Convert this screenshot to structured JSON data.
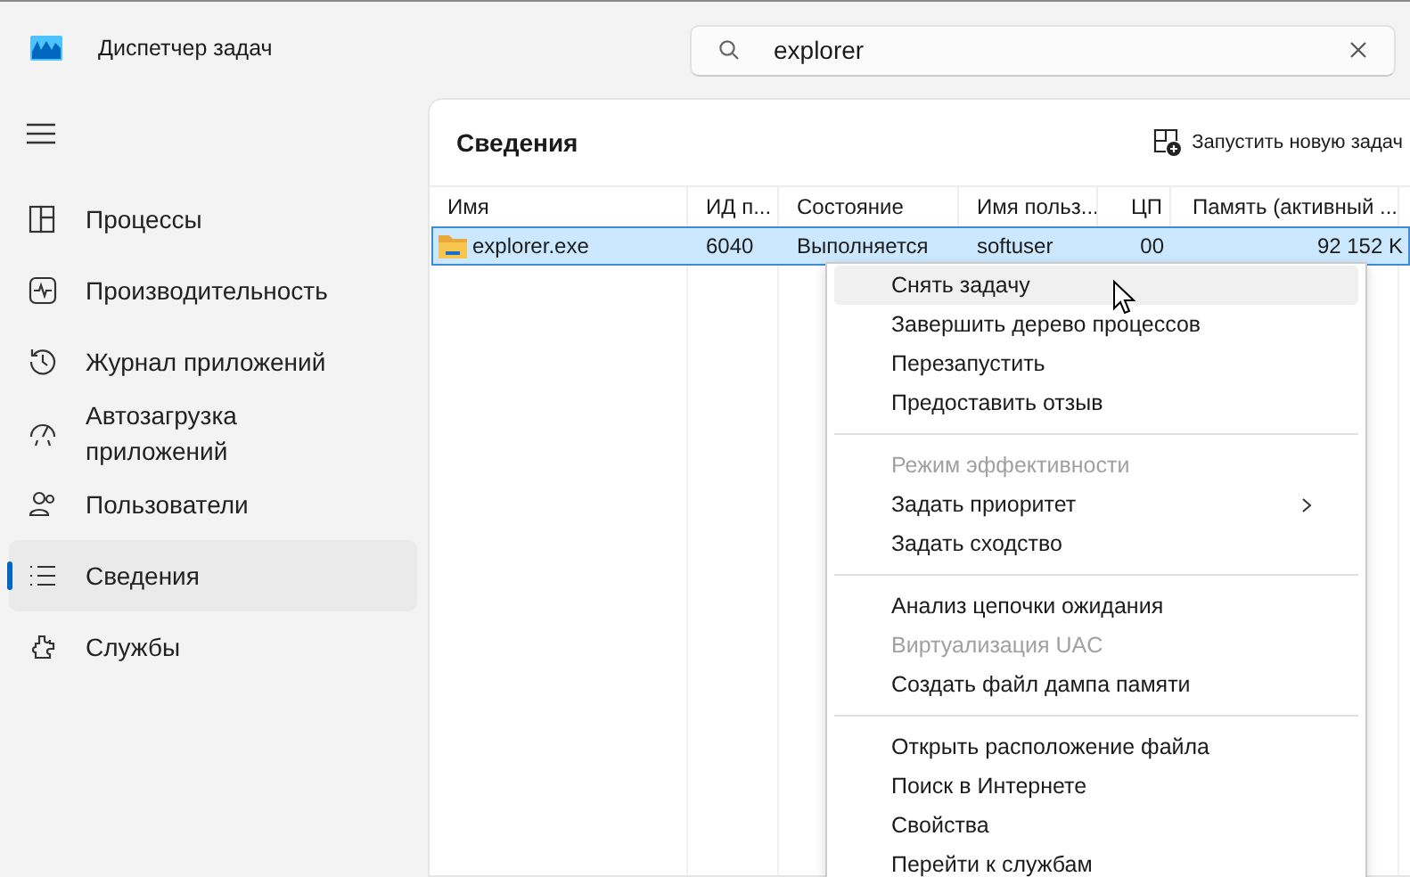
{
  "window": {
    "title": "Диспетчер задач"
  },
  "search": {
    "value": "explorer"
  },
  "sidebar": {
    "items": [
      {
        "label": "Процессы",
        "selected": false
      },
      {
        "label": "Производительность",
        "selected": false
      },
      {
        "label": "Журнал приложений",
        "selected": false
      },
      {
        "label": "Автозагрузка приложений",
        "selected": false
      },
      {
        "label": "Пользователи",
        "selected": false
      },
      {
        "label": "Сведения",
        "selected": true
      },
      {
        "label": "Службы",
        "selected": false
      }
    ]
  },
  "panel": {
    "title": "Сведения",
    "action": "Запустить новую задач"
  },
  "table": {
    "columns": [
      "Имя",
      "ИД п...",
      "Состояние",
      "Имя польз...",
      "ЦП",
      "Память (активный ..."
    ],
    "rows": [
      {
        "cells": [
          "explorer.exe",
          "6040",
          "Выполняется",
          "softuser",
          "00",
          "92 152 K"
        ],
        "selected": true
      }
    ]
  },
  "context_menu": {
    "items": [
      {
        "kind": "item",
        "label": "Снять задачу",
        "disabled": false,
        "hovered": true
      },
      {
        "kind": "item",
        "label": "Завершить дерево процессов",
        "disabled": false,
        "hovered": false
      },
      {
        "kind": "item",
        "label": "Перезапустить",
        "disabled": false,
        "hovered": false
      },
      {
        "kind": "item",
        "label": "Предоставить отзыв",
        "disabled": false,
        "hovered": false
      },
      {
        "kind": "separator"
      },
      {
        "kind": "item",
        "label": "Режим эффективности",
        "disabled": true,
        "hovered": false
      },
      {
        "kind": "submenu",
        "label": "Задать приоритет",
        "disabled": false,
        "hovered": false
      },
      {
        "kind": "item",
        "label": "Задать сходство",
        "disabled": false,
        "hovered": false
      },
      {
        "kind": "separator"
      },
      {
        "kind": "item",
        "label": "Анализ цепочки ожидания",
        "disabled": false,
        "hovered": false
      },
      {
        "kind": "item",
        "label": "Виртуализация UAC",
        "disabled": true,
        "hovered": false
      },
      {
        "kind": "item",
        "label": "Создать файл дампа памяти",
        "disabled": false,
        "hovered": false
      },
      {
        "kind": "separator"
      },
      {
        "kind": "item",
        "label": "Открыть расположение файла",
        "disabled": false,
        "hovered": false
      },
      {
        "kind": "item",
        "label": "Поиск в Интернете",
        "disabled": false,
        "hovered": false
      },
      {
        "kind": "item",
        "label": "Свойства",
        "disabled": false,
        "hovered": false
      },
      {
        "kind": "item",
        "label": "Перейти к службам",
        "disabled": false,
        "hovered": false
      }
    ]
  }
}
